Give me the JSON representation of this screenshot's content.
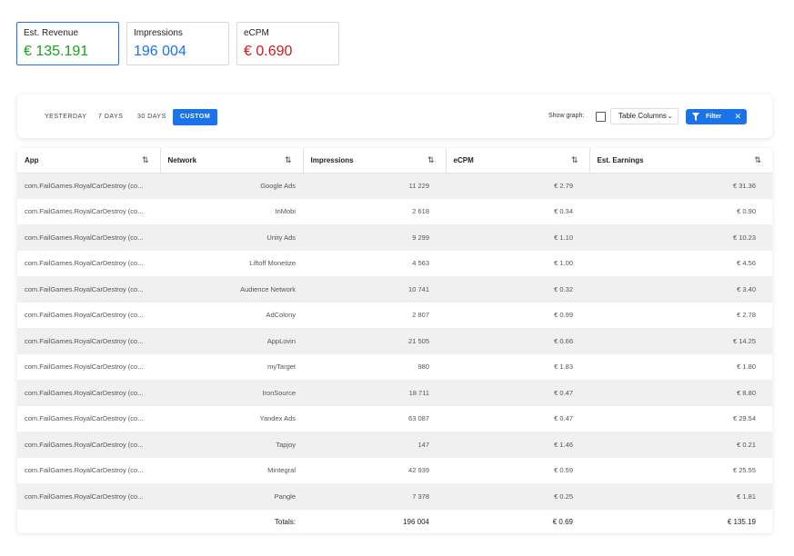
{
  "kpis": [
    {
      "label": "Est. Revenue",
      "value": "€ 135.191",
      "color": "#1aa31a"
    },
    {
      "label": "Impressions",
      "value": "196 004",
      "color": "#1a73e8"
    },
    {
      "label": "eCPM",
      "value": "€ 0.690",
      "color": "#d11a1a"
    }
  ],
  "toolbar": {
    "ranges": [
      "YESTERDAY",
      "7 DAYS",
      "30 DAYS",
      "CUSTOM"
    ],
    "active_range": "CUSTOM",
    "show_graph_label": "Show graph:",
    "columns_label": "Table Columns",
    "filter_label": "Filter",
    "accent": "#1a73e8"
  },
  "table": {
    "headers": [
      "App",
      "Network",
      "Impressions",
      "eCPM",
      "Est. Earnings"
    ],
    "rows": [
      [
        "com.FailGames.RoyalCarDestroy (co...",
        "Google Ads",
        "11 229",
        "€ 2.79",
        "€ 31.36"
      ],
      [
        "com.FailGames.RoyalCarDestroy (co...",
        "InMobi",
        "2 618",
        "€ 0.34",
        "€ 0.90"
      ],
      [
        "com.FailGames.RoyalCarDestroy (co...",
        "Unity Ads",
        "9 299",
        "€ 1.10",
        "€ 10.23"
      ],
      [
        "com.FailGames.RoyalCarDestroy (co...",
        "Liftoff Monetize",
        "4 563",
        "€ 1.00",
        "€ 4.56"
      ],
      [
        "com.FailGames.RoyalCarDestroy (co...",
        "Audience Network",
        "10 741",
        "€ 0.32",
        "€ 3.40"
      ],
      [
        "com.FailGames.RoyalCarDestroy (co...",
        "AdColony",
        "2 807",
        "€ 0.99",
        "€ 2.78"
      ],
      [
        "com.FailGames.RoyalCarDestroy (co...",
        "AppLovin",
        "21 505",
        "€ 0.66",
        "€ 14.25"
      ],
      [
        "com.FailGames.RoyalCarDestroy (co...",
        "myTarget",
        "980",
        "€ 1.83",
        "€ 1.80"
      ],
      [
        "com.FailGames.RoyalCarDestroy (co...",
        "IronSource",
        "18 711",
        "€ 0.47",
        "€ 8.80"
      ],
      [
        "com.FailGames.RoyalCarDestroy (co...",
        "Yandex Ads",
        "63 087",
        "€ 0.47",
        "€ 29.54"
      ],
      [
        "com.FailGames.RoyalCarDestroy (co...",
        "Tapjoy",
        "147",
        "€ 1.46",
        "€ 0.21"
      ],
      [
        "com.FailGames.RoyalCarDestroy (co...",
        "Mintegral",
        "42 939",
        "€ 0.59",
        "€ 25.55"
      ],
      [
        "com.FailGames.RoyalCarDestroy (co...",
        "Pangle",
        "7 378",
        "€ 0.25",
        "€ 1.81"
      ]
    ],
    "totals": {
      "label": "Totals:",
      "impressions": "196 004",
      "ecpm": "€ 0.69",
      "earnings": "€ 135.19"
    }
  }
}
